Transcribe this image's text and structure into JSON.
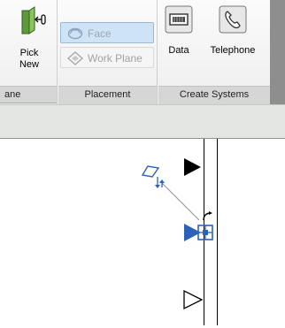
{
  "ribbon": {
    "pick_new_label": "Pick\nNew",
    "plane_panel_title": "ane",
    "face_label": "Face",
    "work_plane_label": "Work Plane",
    "placement_panel_title": "Placement",
    "data_label": "Data",
    "telephone_label": "Telephone",
    "create_systems_panel_title": "Create Systems"
  },
  "icons": {
    "pick_new": "pick-new-icon",
    "face": "face-icon",
    "work_plane": "work-plane-icon",
    "data": "data-device-icon",
    "telephone": "telephone-icon"
  },
  "colors": {
    "selection_blue": "#2c63b8",
    "ribbon_green": "#5f9a3a"
  }
}
